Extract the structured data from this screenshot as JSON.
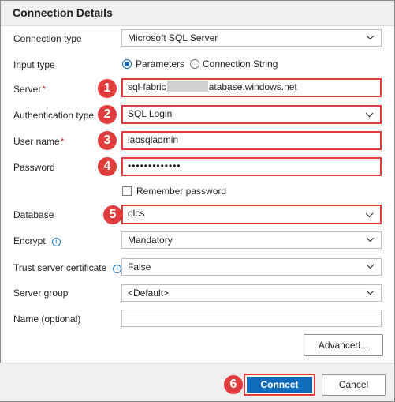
{
  "panel": {
    "title": "Connection Details"
  },
  "fields": {
    "connection_type": {
      "label": "Connection type",
      "value": "Microsoft SQL Server"
    },
    "input_type": {
      "label": "Input type",
      "options": [
        "Parameters",
        "Connection String"
      ],
      "selected": "Parameters"
    },
    "server": {
      "label": "Server",
      "value_prefix": "sql-fabric",
      "value_suffix": "atabase.windows.net"
    },
    "auth_type": {
      "label": "Authentication type",
      "value": "SQL Login"
    },
    "user_name": {
      "label": "User name",
      "value": "labsqladmin"
    },
    "password": {
      "label": "Password",
      "value": "•••••••••••••"
    },
    "remember_password": {
      "label": "Remember password",
      "checked": false
    },
    "database": {
      "label": "Database",
      "value": "olcs"
    },
    "encrypt": {
      "label": "Encrypt",
      "value": "Mandatory"
    },
    "trust_cert": {
      "label": "Trust server certificate",
      "value": "False"
    },
    "server_group": {
      "label": "Server group",
      "value": "<Default>"
    },
    "name_optional": {
      "label": "Name (optional)",
      "value": ""
    }
  },
  "required_marker": "*",
  "badges": [
    "1",
    "2",
    "3",
    "4",
    "5",
    "6"
  ],
  "buttons": {
    "advanced": "Advanced...",
    "connect": "Connect",
    "cancel": "Cancel"
  },
  "colors": {
    "accent": "#0f6cbd",
    "highlight": "#e03c3c",
    "header_bg": "#efefef"
  }
}
